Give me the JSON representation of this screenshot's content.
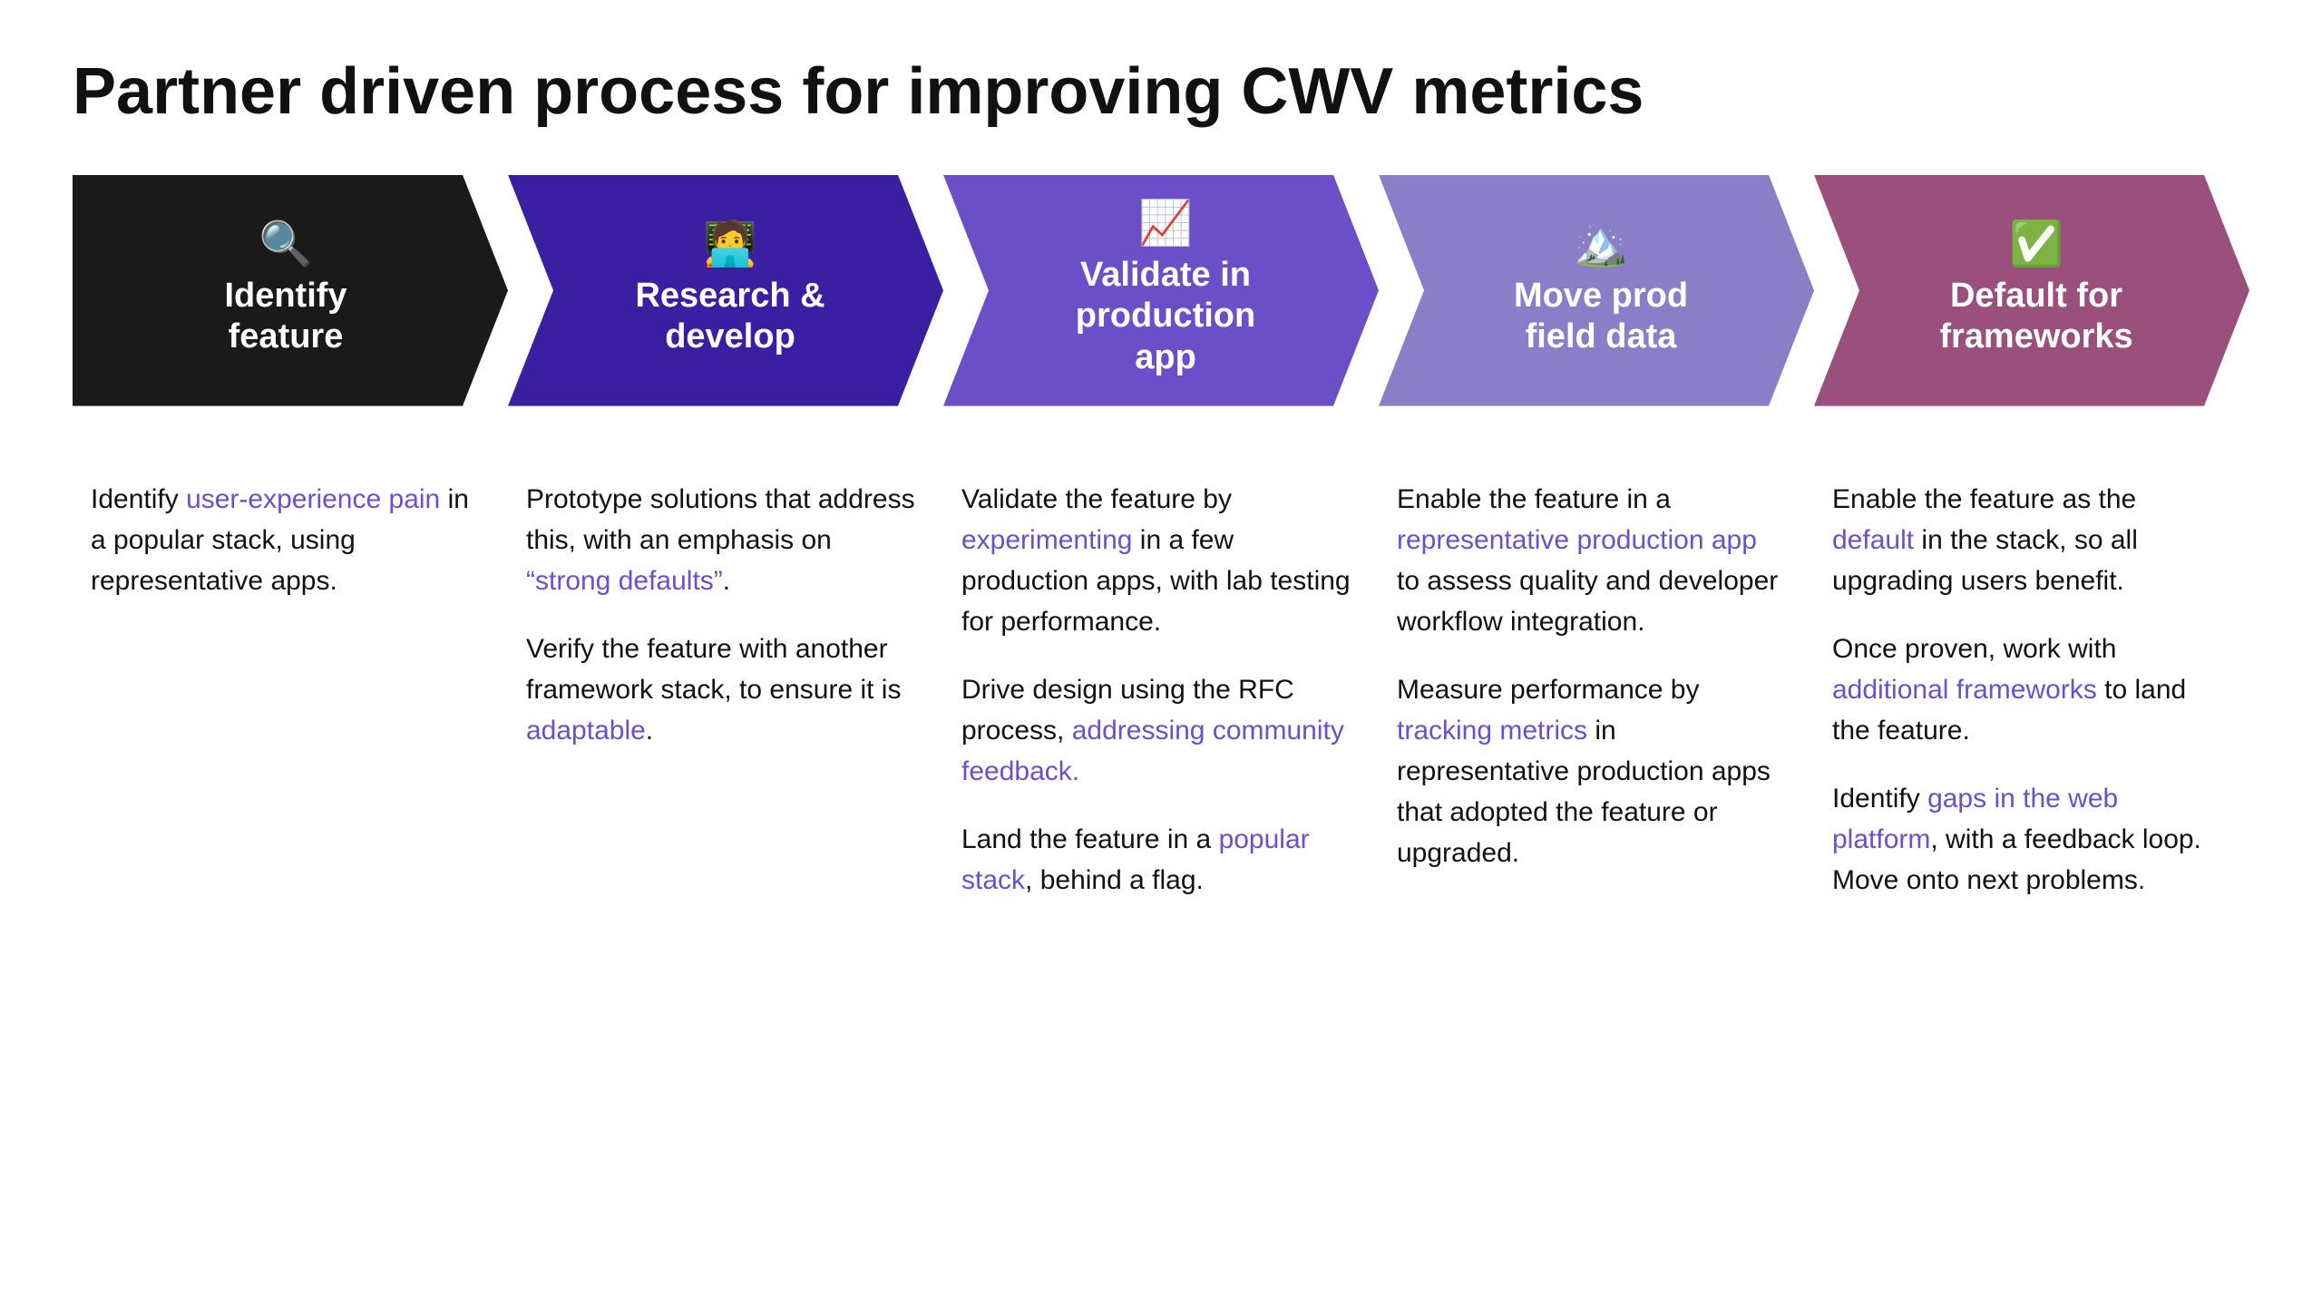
{
  "title": "Partner driven process for improving CWV metrics",
  "steps": [
    {
      "id": "identify-feature",
      "icon": "🔍",
      "title": "Identify\nfeature",
      "color": "#1a1a1a",
      "content": [
        {
          "parts": [
            {
              "text": "Identify ",
              "type": "normal"
            },
            {
              "text": "user-experience pain",
              "type": "link"
            },
            {
              "text": " in a popular stack, using representative apps.",
              "type": "normal"
            }
          ]
        }
      ]
    },
    {
      "id": "research-develop",
      "icon": "🧑‍💻",
      "title": "Research &\ndevelop",
      "color": "#3b1fa3",
      "content": [
        {
          "parts": [
            {
              "text": "Prototype solutions that address this, with an emphasis on ",
              "type": "normal"
            },
            {
              "text": "“strong defaults”",
              "type": "link"
            },
            {
              "text": ".",
              "type": "normal"
            }
          ]
        },
        {
          "parts": [
            {
              "text": "Verify the feature with another framework stack, to ensure it is ",
              "type": "normal"
            },
            {
              "text": "adaptable",
              "type": "link"
            },
            {
              "text": ".",
              "type": "normal"
            }
          ]
        }
      ]
    },
    {
      "id": "validate-production",
      "icon": "📈",
      "title": "Validate in\nproduction\napp",
      "color": "#6b4fc8",
      "content": [
        {
          "parts": [
            {
              "text": "Validate the feature by ",
              "type": "normal"
            },
            {
              "text": "experimenting",
              "type": "link"
            },
            {
              "text": " in a few production apps, with lab testing for performance.",
              "type": "normal"
            }
          ]
        },
        {
          "parts": [
            {
              "text": "Drive design using the RFC process, ",
              "type": "normal"
            },
            {
              "text": "addressing community feedback.",
              "type": "link"
            }
          ]
        },
        {
          "parts": [
            {
              "text": "Land the feature in a ",
              "type": "normal"
            },
            {
              "text": "popular stack",
              "type": "link"
            },
            {
              "text": ", behind a flag.",
              "type": "normal"
            }
          ]
        }
      ]
    },
    {
      "id": "move-prod-field-data",
      "icon": "🏔️",
      "title": "Move prod\nfield data",
      "color": "#8b7ec8",
      "content": [
        {
          "parts": [
            {
              "text": "Enable the feature in a ",
              "type": "normal"
            },
            {
              "text": "representative production app",
              "type": "link"
            },
            {
              "text": " to assess quality and developer workflow integration.",
              "type": "normal"
            }
          ]
        },
        {
          "parts": [
            {
              "text": "Measure performance by ",
              "type": "normal"
            },
            {
              "text": "tracking metrics",
              "type": "link"
            },
            {
              "text": " in representative production apps that adopted the feature or upgraded.",
              "type": "normal"
            }
          ]
        }
      ]
    },
    {
      "id": "default-frameworks",
      "icon": "✅",
      "title": "Default for\nframeworks",
      "color": "#9b4f7c",
      "content": [
        {
          "parts": [
            {
              "text": "Enable the feature as the ",
              "type": "normal"
            },
            {
              "text": "default",
              "type": "link"
            },
            {
              "text": " in the stack, so all upgrading users benefit.",
              "type": "normal"
            }
          ]
        },
        {
          "parts": [
            {
              "text": "Once proven, work with ",
              "type": "normal"
            },
            {
              "text": "additional frameworks",
              "type": "link"
            },
            {
              "text": " to land the feature.",
              "type": "normal"
            }
          ]
        },
        {
          "parts": [
            {
              "text": "Identify ",
              "type": "normal"
            },
            {
              "text": "gaps in the web platform",
              "type": "link"
            },
            {
              "text": ", with a feedback loop. Move onto next problems.",
              "type": "normal"
            }
          ]
        }
      ]
    }
  ]
}
